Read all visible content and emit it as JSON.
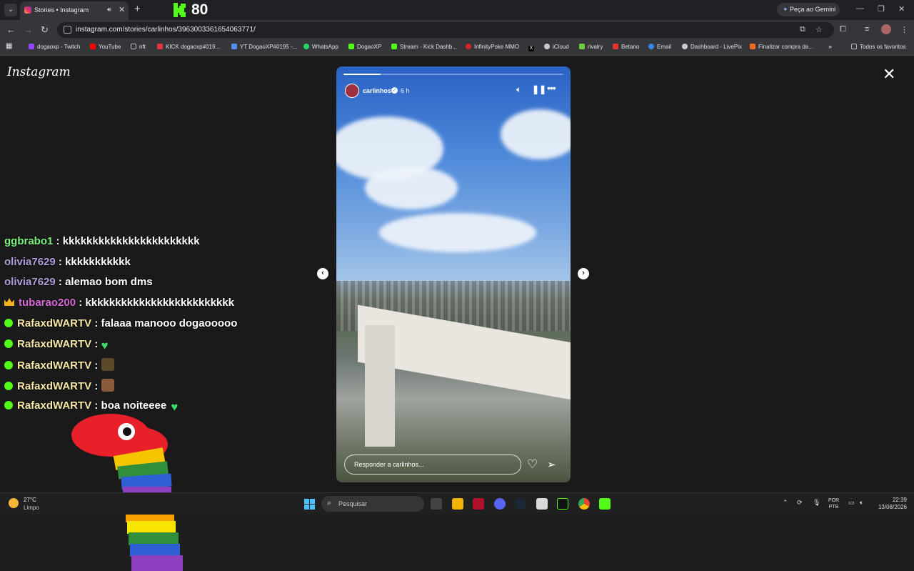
{
  "browser": {
    "tab_title": "Stories • Instagram",
    "new_tab_symbol": "+",
    "kick_count": "80",
    "gemini_label": "Peça ao Gemini",
    "url": "instagram.com/stories/carlinhos/3963003361654063771/",
    "bookmarks": [
      {
        "label": "dogaoxp - Twitch",
        "color": "#9146ff"
      },
      {
        "label": "YouTube",
        "color": "#ff0000"
      },
      {
        "label": "nft",
        "color": "#888888"
      },
      {
        "label": "KICK dogaoxp#019...",
        "color": "#e0383e"
      },
      {
        "label": "YT DogaoXP#0195 -...",
        "color": "#5b8def"
      },
      {
        "label": "WhatsApp",
        "color": "#25d366"
      },
      {
        "label": "DogaoXP",
        "color": "#53fc18"
      },
      {
        "label": "Stream - Kick Dashb...",
        "color": "#53fc18"
      },
      {
        "label": "InfinityPoke MMO",
        "color": "#d22"
      },
      {
        "label": "",
        "color": "#000000"
      },
      {
        "label": "iCloud",
        "color": "#cccccc"
      },
      {
        "label": "rivalry",
        "color": "#6bd13b"
      },
      {
        "label": "Betano",
        "color": "#e5322d"
      },
      {
        "label": "Email",
        "color": "#3b82f6"
      },
      {
        "label": "Dashboard - LivePix",
        "color": "#cccccc"
      },
      {
        "label": "Finalizar compra da...",
        "color": "#f26b1d"
      }
    ],
    "all_bookmarks": "Todos os favoritos"
  },
  "instagram": {
    "logo": "Instagram",
    "story": {
      "username": "carlinhos",
      "time": "6 h",
      "reply_placeholder": "Responder a carlinhos...",
      "progress": 0.17
    }
  },
  "chat": [
    {
      "user": "ggbrabo1",
      "color": "#7df07d",
      "msg": "kkkkkkkkkkkkkkkkkkkkkkk",
      "badge": "none"
    },
    {
      "user": "olivia7629",
      "color": "#b39ddb",
      "msg": "kkkkkkkkkkk",
      "badge": "none"
    },
    {
      "user": "olivia7629",
      "color": "#b39ddb",
      "msg": "alemao bom dms",
      "badge": "none"
    },
    {
      "user": "tubarao200",
      "color": "#d66ad6",
      "msg": "kkkkkkkkkkkkkkkkkkkkkkkkk",
      "badge": "crown"
    },
    {
      "user": "RafaxdWARTV",
      "color": "#f5e6a6",
      "msg": "falaaa manooo dogaooooo",
      "badge": "check"
    },
    {
      "user": "RafaxdWARTV",
      "color": "#f5e6a6",
      "msg": "",
      "badge": "check",
      "emote": "green-heart"
    },
    {
      "user": "RafaxdWARTV",
      "color": "#f5e6a6",
      "msg": "",
      "badge": "check",
      "emote": "emote-face-1"
    },
    {
      "user": "RafaxdWARTV",
      "color": "#f5e6a6",
      "msg": "",
      "badge": "check",
      "emote": "emote-face-2"
    },
    {
      "user": "RafaxdWARTV",
      "color": "#f5e6a6",
      "msg": "boa noiteeee",
      "badge": "check",
      "emote": "green-heart"
    }
  ],
  "taskbar": {
    "weather_temp": "27°C",
    "weather_desc": "Limpo",
    "search_placeholder": "Pesquisar",
    "lang_line1": "POR",
    "lang_line2": "PTB",
    "time": "22:39",
    "date": "13/08/2026"
  }
}
